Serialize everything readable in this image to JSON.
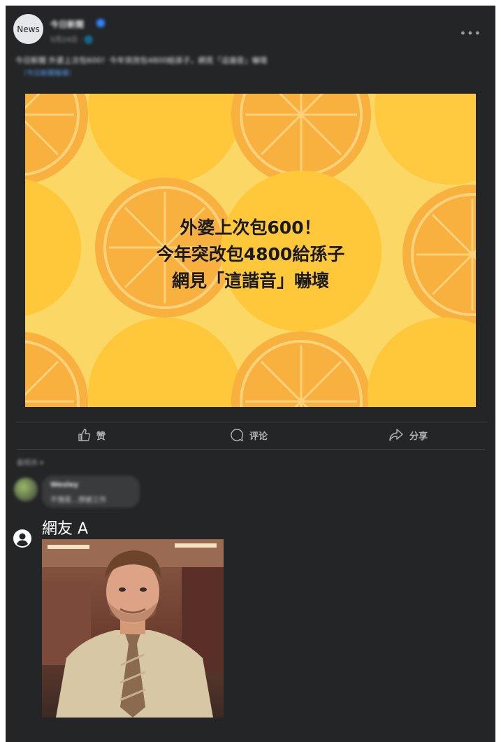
{
  "post": {
    "avatar_text": "News",
    "page_name": "今日新聞",
    "meta": "5月24日 · 🌐",
    "caption": "今日新聞 外婆上次包600！今年突改包4800給孫子，網見「這諧音」嚇壞",
    "link_text": "（今日新聞報導）",
    "more_icon": "more-icon"
  },
  "headline": {
    "line1": "外婆上次包600！",
    "line2": "今年突改包4800給孫子",
    "line3": "網見「這諧音」嚇壞"
  },
  "actions": {
    "like": "赞",
    "comment": "评论",
    "share": "分享"
  },
  "comments": {
    "sort_label": "最相关 ▾",
    "blurred": {
      "name": "Wesley",
      "text": "不愧是…想被工作"
    },
    "featured": {
      "name": "網友 A"
    }
  },
  "colors": {
    "card_bg": "#242526",
    "hero_bg": "#fbd866",
    "orange": "#f7ae35",
    "text": "#e4e6eb"
  }
}
